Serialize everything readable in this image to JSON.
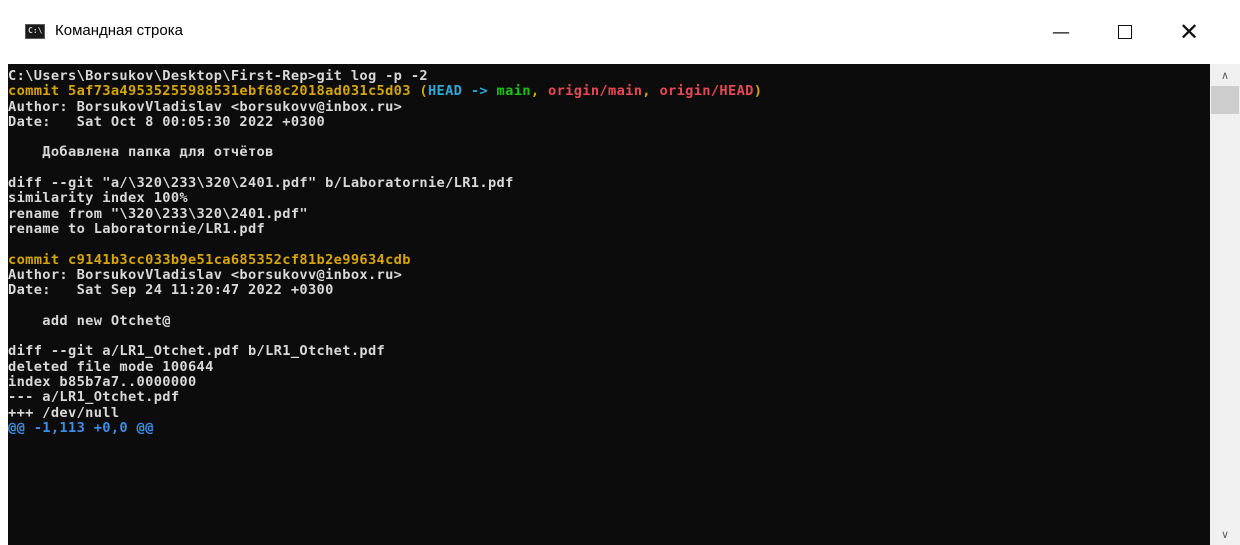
{
  "window": {
    "title": "Командная строка",
    "icon_label": "C:\\",
    "min_glyph": "—",
    "close_glyph": "✕"
  },
  "colors": {
    "default": "#d8d8d8",
    "yellow": "#d7a600",
    "cyan": "#2ea8d6",
    "green": "#16c60c",
    "red": "#e74856",
    "blue": "#3b8eea"
  },
  "console": {
    "lines": [
      [
        {
          "text": "C:\\Users\\Borsukov\\Desktop\\First-Rep>git log -p -2",
          "color": "default"
        }
      ],
      [
        {
          "text": "commit 5af73a49535255988531ebf68c2018ad031c5d03 ",
          "color": "yellow"
        },
        {
          "text": "(",
          "color": "yellow"
        },
        {
          "text": "HEAD -> ",
          "color": "cyan"
        },
        {
          "text": "main",
          "color": "green"
        },
        {
          "text": ", ",
          "color": "yellow"
        },
        {
          "text": "origin/main",
          "color": "red"
        },
        {
          "text": ", ",
          "color": "yellow"
        },
        {
          "text": "origin/HEAD",
          "color": "red"
        },
        {
          "text": ")",
          "color": "yellow"
        }
      ],
      [
        {
          "text": "Author: BorsukovVladislav <borsukovv@inbox.ru>",
          "color": "default"
        }
      ],
      [
        {
          "text": "Date:   Sat Oct 8 00:05:30 2022 +0300",
          "color": "default"
        }
      ],
      [
        {
          "text": "",
          "color": "default"
        }
      ],
      [
        {
          "text": "    Добавлена папка для отчётов",
          "color": "default"
        }
      ],
      [
        {
          "text": "",
          "color": "default"
        }
      ],
      [
        {
          "text": "diff --git \"a/\\320\\233\\320\\2401.pdf\" b/Laboratornie/LR1.pdf",
          "color": "default"
        }
      ],
      [
        {
          "text": "similarity index 100%",
          "color": "default"
        }
      ],
      [
        {
          "text": "rename from \"\\320\\233\\320\\2401.pdf\"",
          "color": "default"
        }
      ],
      [
        {
          "text": "rename to Laboratornie/LR1.pdf",
          "color": "default"
        }
      ],
      [
        {
          "text": "",
          "color": "default"
        }
      ],
      [
        {
          "text": "commit c9141b3cc033b9e51ca685352cf81b2e99634cdb",
          "color": "yellow"
        }
      ],
      [
        {
          "text": "Author: BorsukovVladislav <borsukovv@inbox.ru>",
          "color": "default"
        }
      ],
      [
        {
          "text": "Date:   Sat Sep 24 11:20:47 2022 +0300",
          "color": "default"
        }
      ],
      [
        {
          "text": "",
          "color": "default"
        }
      ],
      [
        {
          "text": "    add new Otchet@",
          "color": "default"
        }
      ],
      [
        {
          "text": "",
          "color": "default"
        }
      ],
      [
        {
          "text": "diff --git a/LR1_Otchet.pdf b/LR1_Otchet.pdf",
          "color": "default"
        }
      ],
      [
        {
          "text": "deleted file mode 100644",
          "color": "default"
        }
      ],
      [
        {
          "text": "index b85b7a7..0000000",
          "color": "default"
        }
      ],
      [
        {
          "text": "--- a/LR1_Otchet.pdf",
          "color": "default"
        }
      ],
      [
        {
          "text": "+++ /dev/null",
          "color": "default"
        }
      ],
      [
        {
          "text": "@@ -1,113 +0,0 @@",
          "color": "blue"
        }
      ]
    ]
  },
  "scrollbar": {
    "up_glyph": "∧",
    "down_glyph": "∨"
  }
}
